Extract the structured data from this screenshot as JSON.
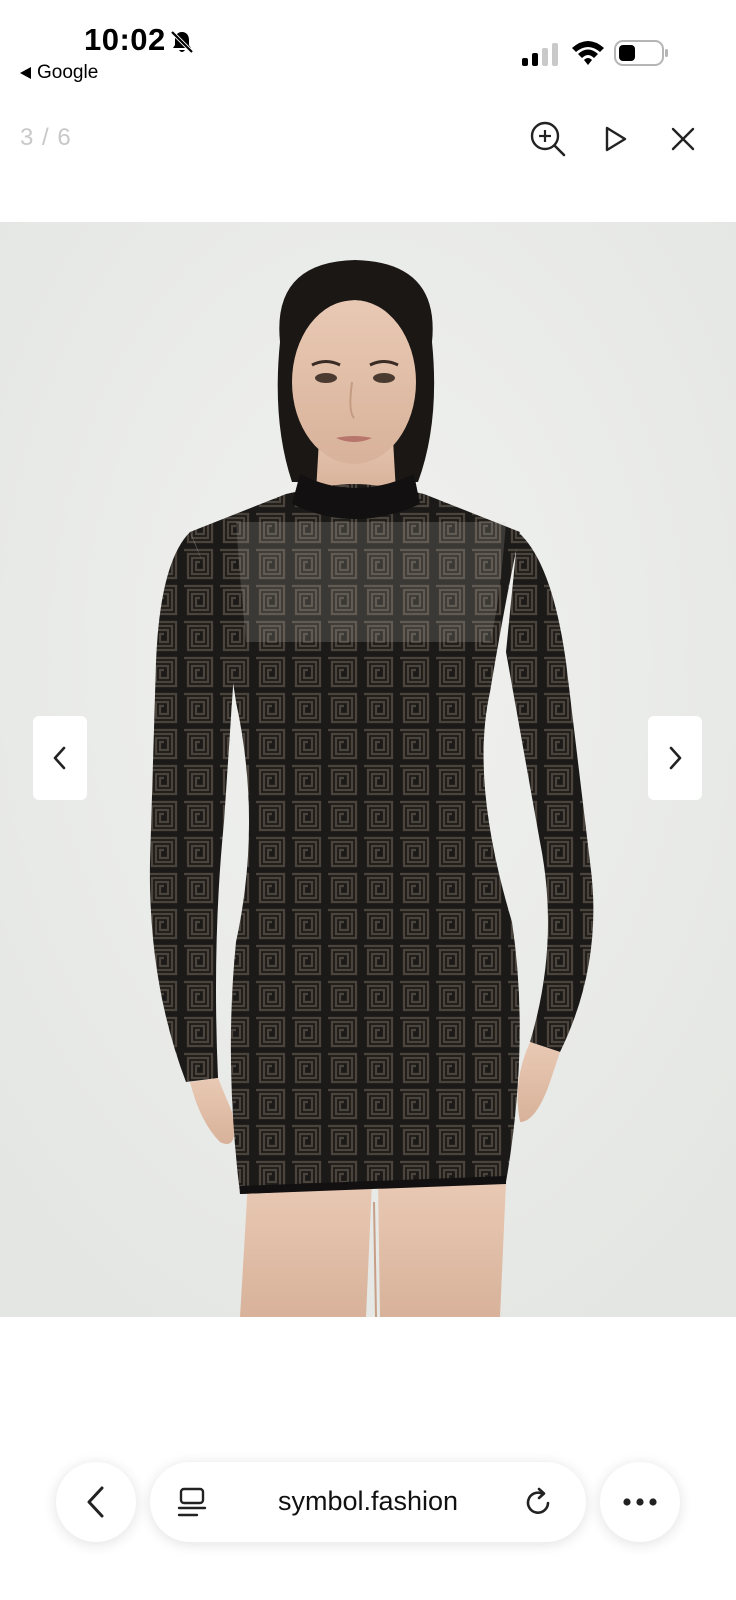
{
  "status_bar": {
    "time": "10:02",
    "back_app_label": "Google",
    "icons": [
      "bell-off-icon",
      "cellular-signal-icon",
      "wifi-icon",
      "battery-icon"
    ]
  },
  "viewer": {
    "counter": "3 / 6",
    "toolbar_icons": [
      "zoom-in-icon",
      "play-icon",
      "close-icon"
    ],
    "prev_icon": "chevron-left-icon",
    "next_icon": "chevron-right-icon"
  },
  "product_image": {
    "alt": "Model wearing black long-sleeve knit mini dress with maze pattern",
    "background_color": "#eceeec",
    "dress_color": "#1c1a18"
  },
  "browser": {
    "url": "symbol.fashion",
    "back_icon": "back-arrow-icon",
    "tabs_icon": "page-menu-icon",
    "reload_icon": "reload-icon",
    "more_icon": "more-icon"
  },
  "colors": {
    "counter_text": "#c8c8c8",
    "surface": "#ffffff"
  }
}
